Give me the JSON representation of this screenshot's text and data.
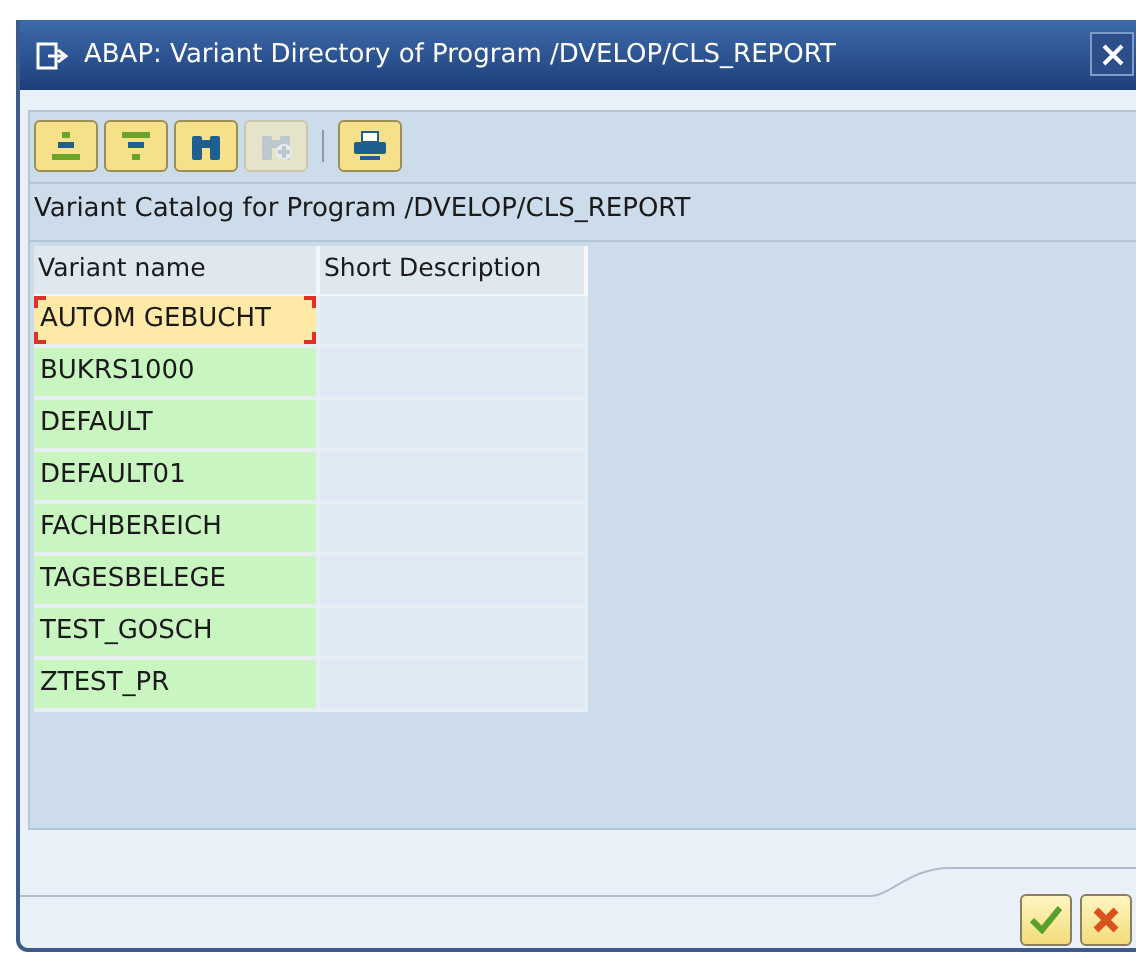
{
  "window": {
    "title": "ABAP: Variant Directory of Program /DVELOP/CLS_REPORT"
  },
  "toolbar": [
    {
      "kind": "expand",
      "disabled": false
    },
    {
      "kind": "collapse",
      "disabled": false
    },
    {
      "kind": "find",
      "disabled": false
    },
    {
      "kind": "find-next",
      "disabled": true
    },
    {
      "kind": "separator"
    },
    {
      "kind": "print",
      "disabled": false
    }
  ],
  "catalog_title": "Variant Catalog for Program /DVELOP/CLS_REPORT",
  "table": {
    "columns": [
      "Variant name",
      "Short Description"
    ],
    "rows": [
      {
        "name": "AUTOM GEBUCHT",
        "selected": true
      },
      {
        "name": "BUKRS1000",
        "selected": false
      },
      {
        "name": "DEFAULT",
        "selected": false
      },
      {
        "name": "DEFAULT01",
        "selected": false
      },
      {
        "name": "FACHBEREICH",
        "selected": false
      },
      {
        "name": "TAGESBELEGE",
        "selected": false
      },
      {
        "name": "TEST_GOSCH",
        "selected": false
      },
      {
        "name": "ZTEST_PR",
        "selected": false
      }
    ]
  },
  "buttons": [
    {
      "kind": "confirm"
    },
    {
      "kind": "cancel"
    }
  ]
}
